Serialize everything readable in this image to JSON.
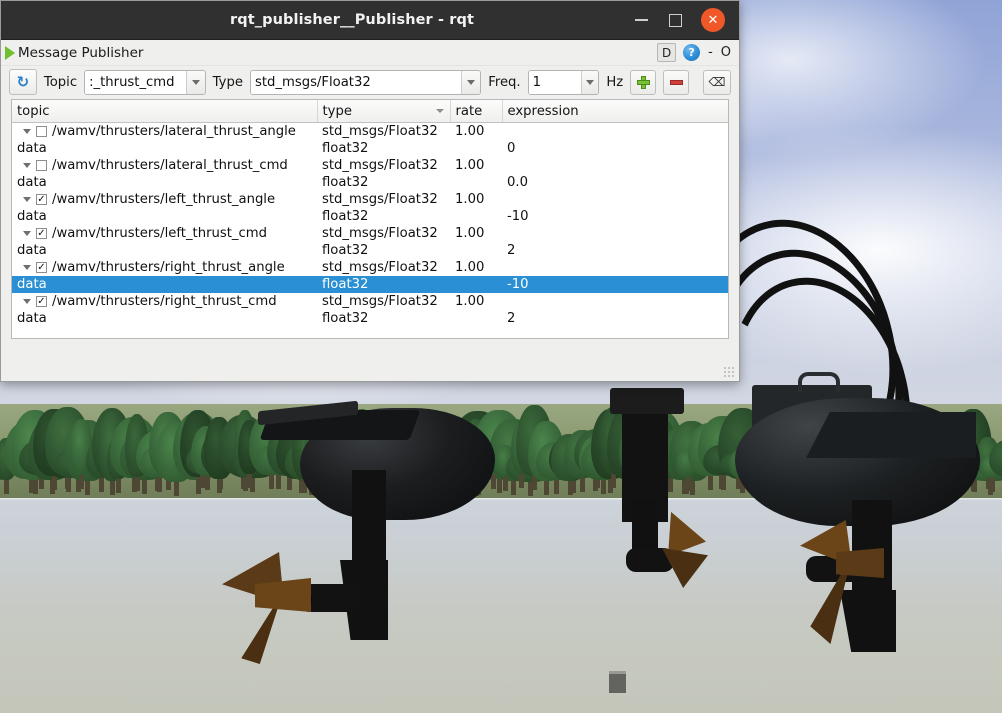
{
  "window": {
    "title": "rqt_publisher__Publisher - rqt",
    "minimize_label": "—",
    "maximize_label": "",
    "close_label": "✕"
  },
  "dock": {
    "title": "Message Publisher",
    "play_icon": "play-icon",
    "button_d": "D",
    "button_help": "?",
    "button_dash": "-",
    "button_o": "O"
  },
  "toolbar": {
    "refresh_icon": "refresh-icon",
    "topic_label": "Topic",
    "topic_value": ":_thrust_cmd",
    "type_label": "Type",
    "type_value": "std_msgs/Float32",
    "freq_label": "Freq.",
    "freq_value": "1",
    "hz_label": "Hz",
    "add_label": "+",
    "remove_label": "-",
    "clear_label": "⌫"
  },
  "table": {
    "columns": [
      {
        "key": "topic",
        "label": "topic"
      },
      {
        "key": "type",
        "label": "type"
      },
      {
        "key": "rate",
        "label": "rate"
      },
      {
        "key": "expression",
        "label": "expression"
      }
    ],
    "rows": [
      {
        "indent": 0,
        "expander": true,
        "checkbox": "unchecked",
        "topic": "/wamv/thrusters/lateral_thrust_angle",
        "type": "std_msgs/Float32",
        "rate": "1.00",
        "expression": "",
        "selected": false
      },
      {
        "indent": 1,
        "expander": false,
        "checkbox": "none",
        "topic": "data",
        "type": "float32",
        "rate": "",
        "expression": "0",
        "selected": false
      },
      {
        "indent": 0,
        "expander": true,
        "checkbox": "unchecked",
        "topic": "/wamv/thrusters/lateral_thrust_cmd",
        "type": "std_msgs/Float32",
        "rate": "1.00",
        "expression": "",
        "selected": false
      },
      {
        "indent": 1,
        "expander": false,
        "checkbox": "none",
        "topic": "data",
        "type": "float32",
        "rate": "",
        "expression": "0.0",
        "selected": false
      },
      {
        "indent": 0,
        "expander": true,
        "checkbox": "checked",
        "topic": "/wamv/thrusters/left_thrust_angle",
        "type": "std_msgs/Float32",
        "rate": "1.00",
        "expression": "",
        "selected": false
      },
      {
        "indent": 1,
        "expander": false,
        "checkbox": "none",
        "topic": "data",
        "type": "float32",
        "rate": "",
        "expression": "-10",
        "selected": false
      },
      {
        "indent": 0,
        "expander": true,
        "checkbox": "checked",
        "topic": "/wamv/thrusters/left_thrust_cmd",
        "type": "std_msgs/Float32",
        "rate": "1.00",
        "expression": "",
        "selected": false
      },
      {
        "indent": 1,
        "expander": false,
        "checkbox": "none",
        "topic": "data",
        "type": "float32",
        "rate": "",
        "expression": "2",
        "selected": false
      },
      {
        "indent": 0,
        "expander": true,
        "checkbox": "checked",
        "topic": "/wamv/thrusters/right_thrust_angle",
        "type": "std_msgs/Float32",
        "rate": "1.00",
        "expression": "",
        "selected": false
      },
      {
        "indent": 1,
        "expander": false,
        "checkbox": "none",
        "topic": "data",
        "type": "float32",
        "rate": "",
        "expression": "-10",
        "selected": true
      },
      {
        "indent": 0,
        "expander": true,
        "checkbox": "checked",
        "topic": "/wamv/thrusters/right_thrust_cmd",
        "type": "std_msgs/Float32",
        "rate": "1.00",
        "expression": "",
        "selected": false
      },
      {
        "indent": 1,
        "expander": false,
        "checkbox": "none",
        "topic": "data",
        "type": "float32",
        "rate": "",
        "expression": "2",
        "selected": false
      }
    ]
  },
  "colors": {
    "selection": "#2a8fd4",
    "titlebar": "#303030",
    "close_button": "#f0582a",
    "help_blue": "#2a8ad4",
    "add_green": "#79c234",
    "remove_red": "#d2403a",
    "window_chrome": "#efefee"
  },
  "scene": {
    "description": "gazebo-simulation-background",
    "sky_color": "#a7b5dd",
    "water_color": "#c7cac5",
    "foliage_color": "#2f5631",
    "propeller_color": "#5a3a17",
    "hull_color": "#121212"
  }
}
